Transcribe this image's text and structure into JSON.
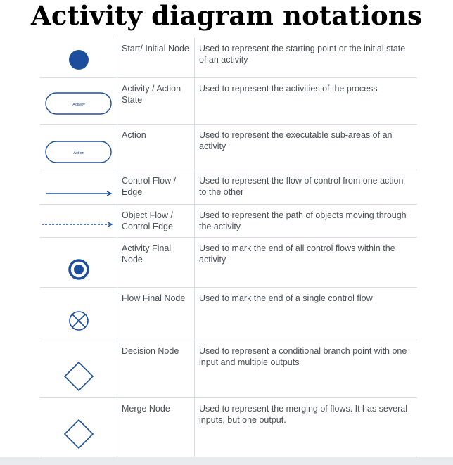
{
  "title": "Activity diagram notations",
  "colors": {
    "symbol": "#1d4e9e",
    "text": "#4a4f55",
    "border": "#d9dce0"
  },
  "rows": [
    {
      "symbol": "filled-circle-icon",
      "name": "Start/ Initial Node",
      "description": "Used to represent the starting point or the initial state of an activity"
    },
    {
      "symbol": "rounded-rectangle-icon",
      "symbol_label": "Activity",
      "name": "Activity / Action State",
      "description": "Used to represent the activities of the process"
    },
    {
      "symbol": "rounded-rectangle-icon",
      "symbol_label": "Action",
      "name": "Action",
      "description": "Used to represent the executable sub-areas of an activity"
    },
    {
      "symbol": "solid-arrow-icon",
      "name": "Control Flow / Edge",
      "description": "Used to represent the flow of control from one action to the other"
    },
    {
      "symbol": "dashed-arrow-icon",
      "name": "Object Flow / Control Edge",
      "description": "Used to represent the path of objects moving through the activity"
    },
    {
      "symbol": "bullseye-icon",
      "name": "Activity Final Node",
      "description": "Used to mark the end of all control flows within the activity"
    },
    {
      "symbol": "circled-x-icon",
      "name": "Flow Final Node",
      "description": "Used  to mark the end of a single control flow"
    },
    {
      "symbol": "diamond-icon",
      "name": "Decision Node",
      "description": "Used to represent a conditional branch point with one input and multiple outputs"
    },
    {
      "symbol": "diamond-icon",
      "name": "Merge Node",
      "description": "Used to represent the merging of flows. It has several inputs, but one output."
    }
  ]
}
